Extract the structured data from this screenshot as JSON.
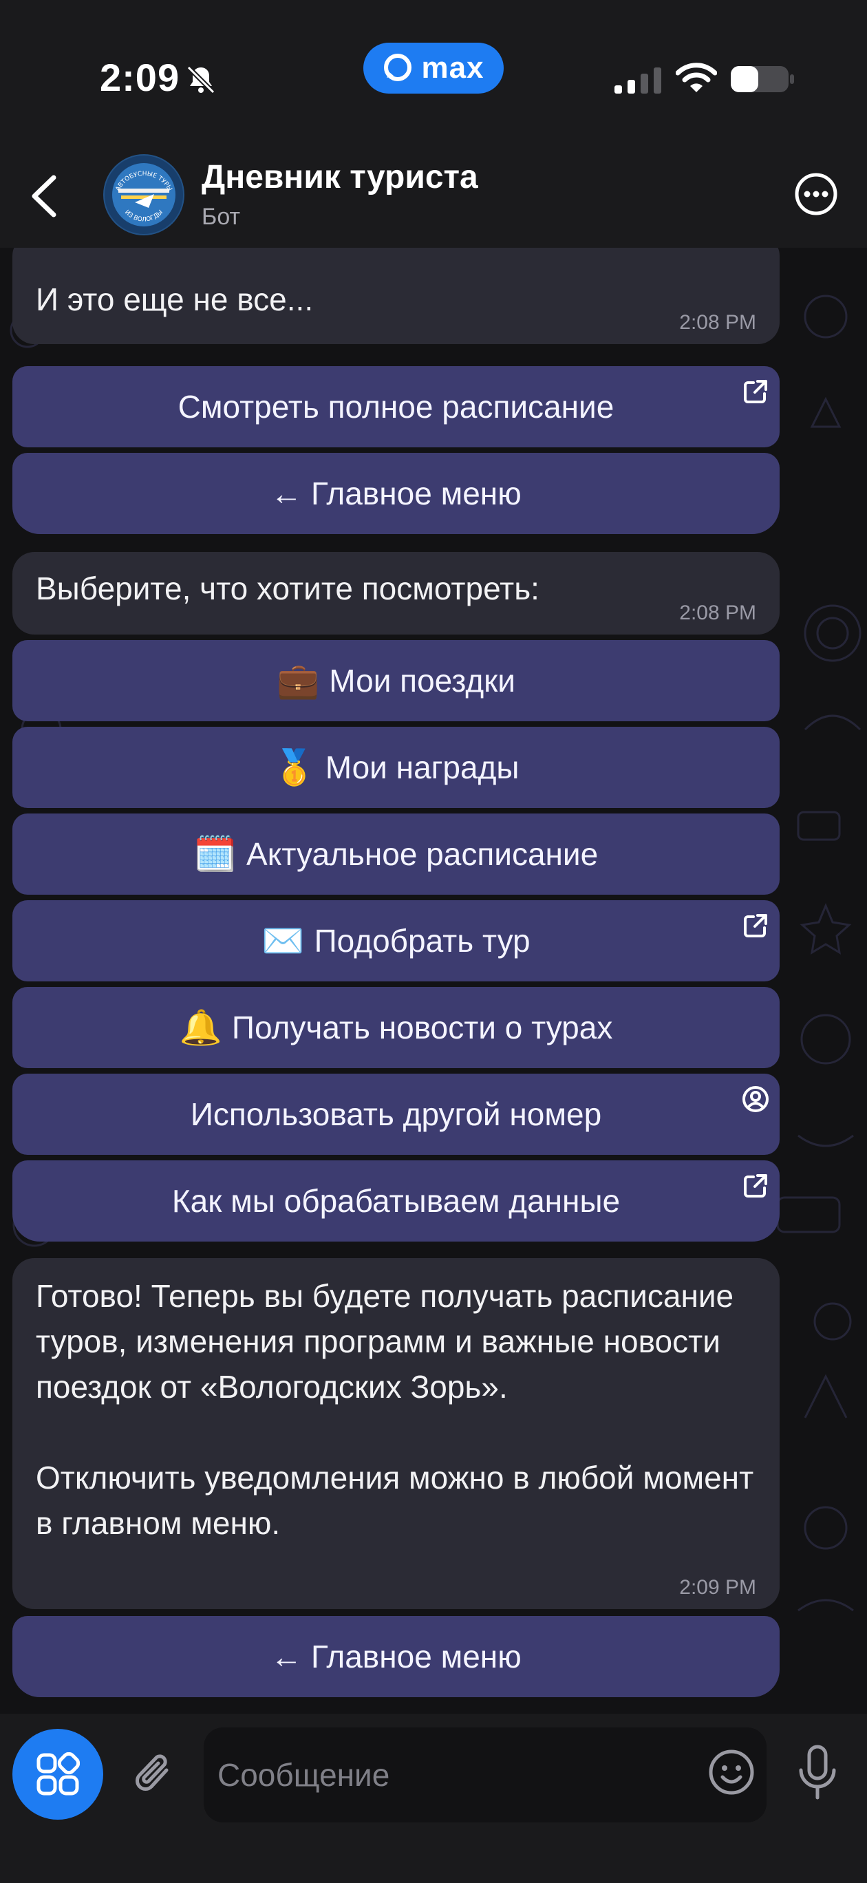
{
  "status_bar": {
    "time": "2:09",
    "app_pill_label": "max"
  },
  "header": {
    "title": "Дневник туриста",
    "subtitle": "Бот",
    "avatar_text_top": "АВТОБУСНЫЕ ТУРЫ",
    "avatar_text_bottom": "ИЗ ВОЛОГДЫ"
  },
  "messages": [
    {
      "text": "И это еще не все...",
      "time": "2:08 PM",
      "buttons": [
        {
          "label": "Смотреть полное расписание",
          "icon": "external-link-icon"
        },
        {
          "label": "← Главное меню"
        }
      ]
    },
    {
      "text": "Выберите, что хотите посмотреть:",
      "time": "2:08 PM",
      "buttons": [
        {
          "emoji": "💼",
          "label": "Мои поездки"
        },
        {
          "emoji": "🥇",
          "label": "Мои награды"
        },
        {
          "emoji": "🗓️",
          "label": "Актуальное расписание"
        },
        {
          "emoji": "✉️",
          "label": "Подобрать тур",
          "icon": "external-link-icon"
        },
        {
          "emoji": "🔔",
          "label": "Получать новости о турах"
        },
        {
          "label": "Использовать другой номер",
          "icon": "contact-icon"
        },
        {
          "label": "Как мы обрабатываем данные",
          "icon": "external-link-icon"
        }
      ]
    },
    {
      "text": "Готово! Теперь вы будете получать расписание туров, изменения программ и важные новости поездок от «Вологодских Зорь».\n\nОтключить уведомления можно в любой момент в главном меню.",
      "time": "2:09 PM",
      "buttons": [
        {
          "label": "← Главное меню"
        }
      ]
    }
  ],
  "composer": {
    "placeholder": "Сообщение"
  },
  "colors": {
    "accent": "#1e7cf2",
    "button_bg": "#3d3c70",
    "bubble_bg": "#2b2b35"
  }
}
